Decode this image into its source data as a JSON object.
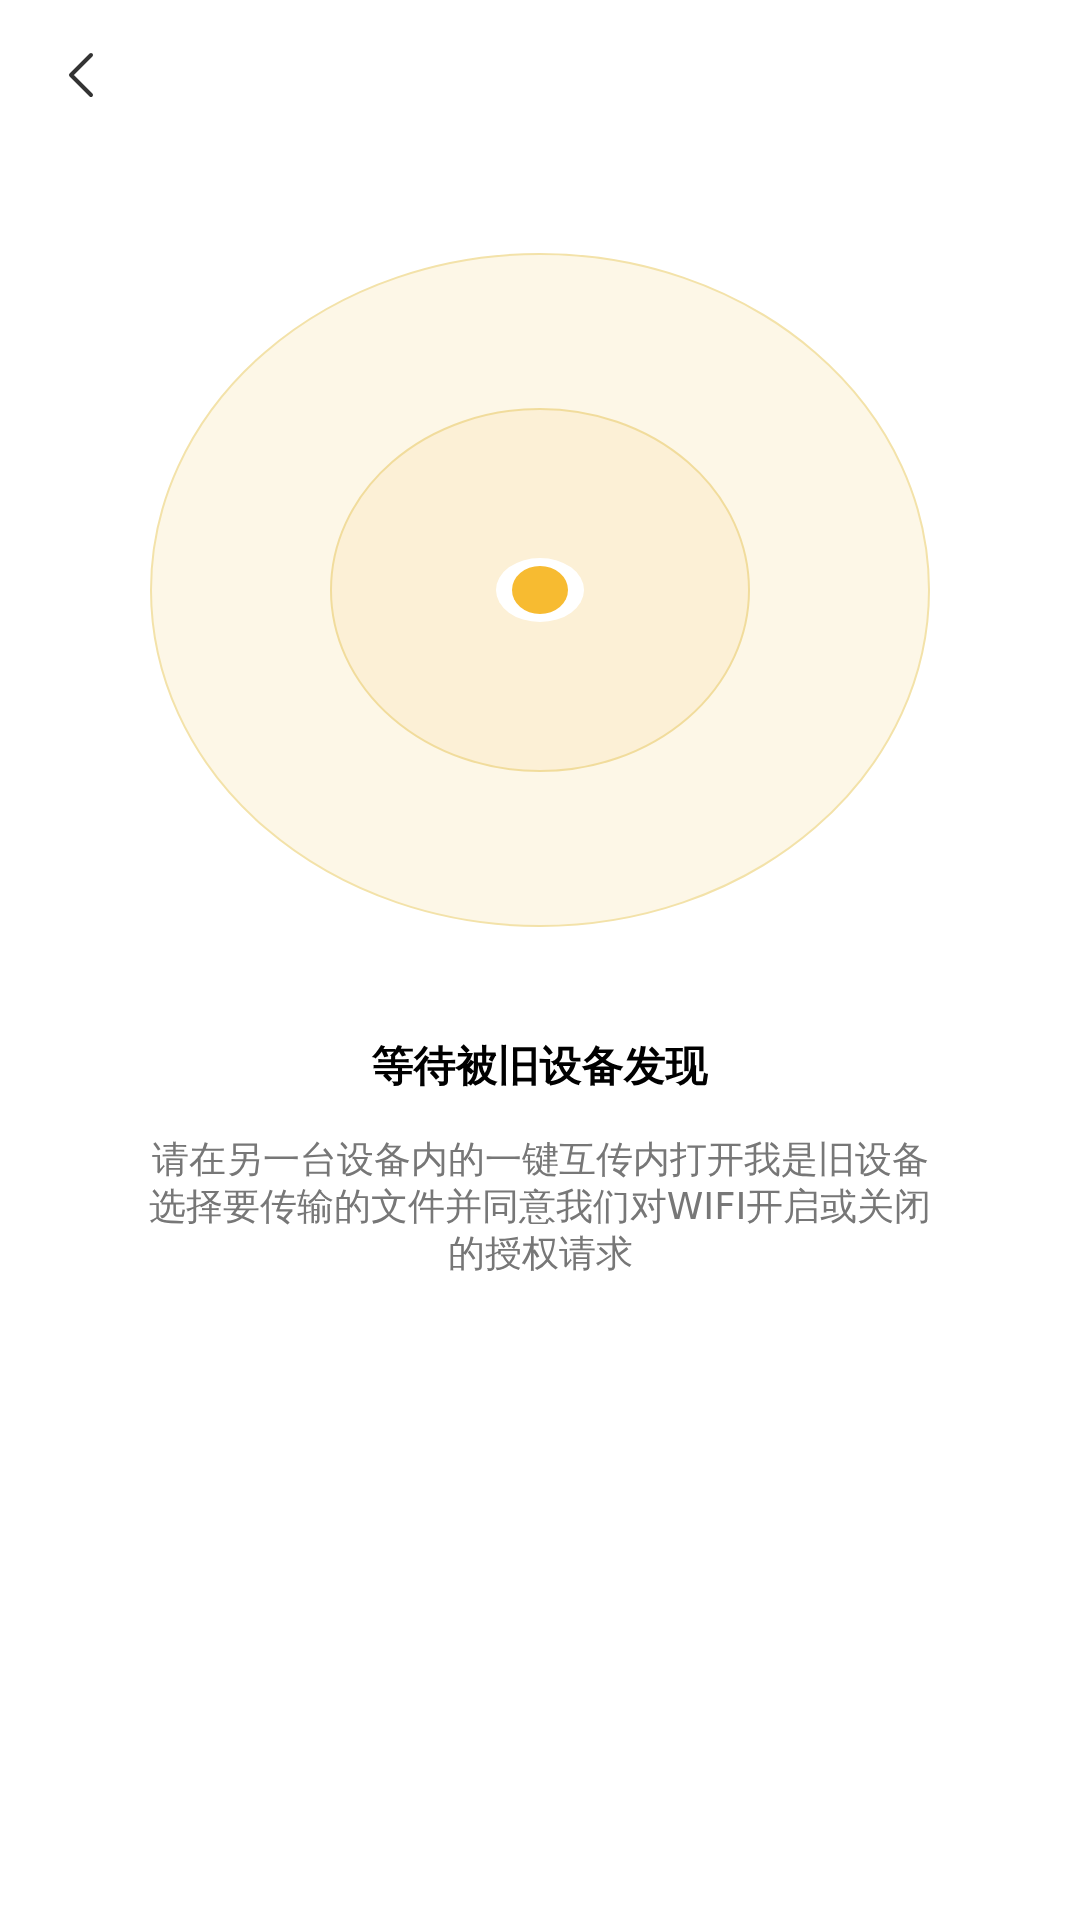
{
  "title": "等待被旧设备发现",
  "description_lines": [
    "请在另一台设备内的一键互传内打开我是旧设备",
    "选择要传输的文件并同意我们对WIFI开启或关闭",
    "的授权请求"
  ]
}
